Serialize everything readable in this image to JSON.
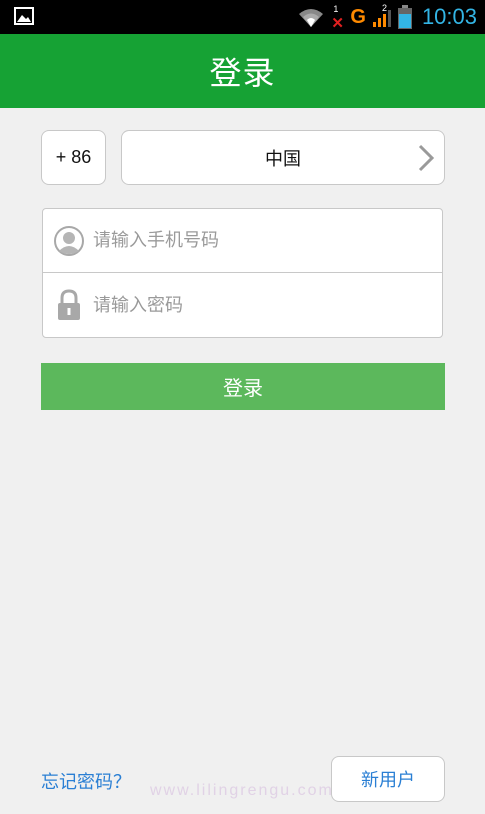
{
  "statusbar": {
    "time": "10:03",
    "network": "G",
    "signal_sup": "2",
    "missed_sup": "1",
    "icons": [
      "gallery-icon",
      "wifi-icon",
      "missed-call-icon",
      "signal-icon",
      "battery-icon"
    ]
  },
  "header": {
    "title": "登录"
  },
  "country": {
    "code": "+ 86",
    "name": "中国"
  },
  "form": {
    "phone_placeholder": "请输入手机号码",
    "password_placeholder": "请输入密码"
  },
  "actions": {
    "login_label": "登录",
    "forgot_label": "忘记密码？",
    "new_user_label": "新用户"
  },
  "watermark": "www.lilingrengu.com",
  "colors": {
    "header_green": "#16a234",
    "button_green": "#5cb85c",
    "link_blue": "#2a7fd4",
    "time_blue": "#33b5e5"
  }
}
